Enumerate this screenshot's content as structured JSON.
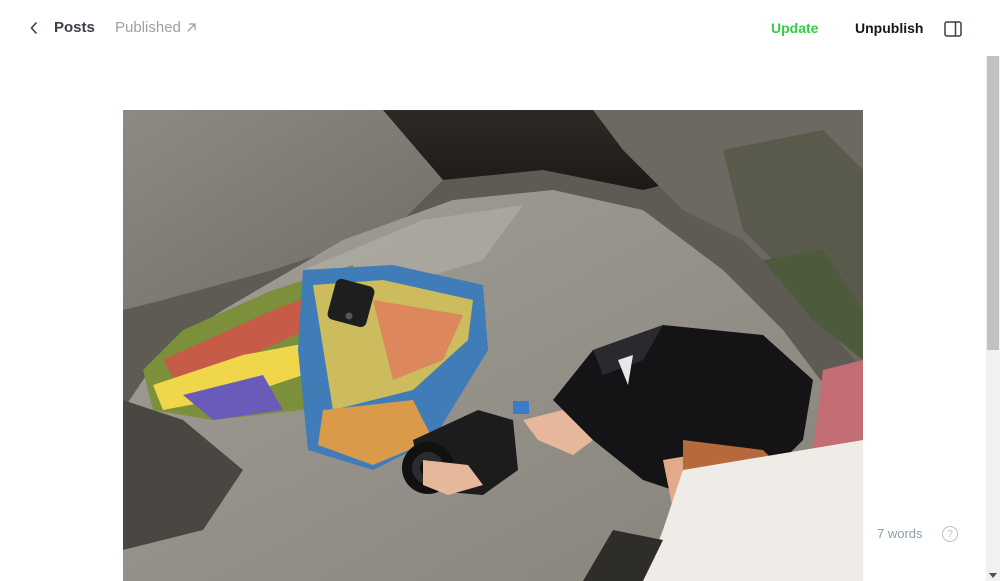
{
  "header": {
    "breadcrumb": "Posts",
    "status": "Published",
    "update_label": "Update",
    "unpublish_label": "Unpublish"
  },
  "footer": {
    "word_count": "7 words",
    "help_glyph": "?"
  },
  "icons": {
    "back": "chevron-left-icon",
    "status_link": "arrow-up-right-icon",
    "sidebar": "sidebar-panel-icon",
    "help": "question-circle-icon"
  },
  "colors": {
    "accent_green": "#30cf43",
    "muted_text": "#99a1a8",
    "primary_text": "#15171a"
  }
}
